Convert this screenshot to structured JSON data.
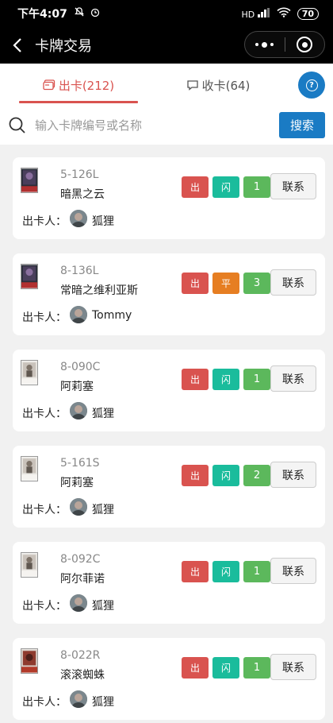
{
  "status_bar": {
    "time": "下午4:07",
    "battery": "70",
    "signal": "HD"
  },
  "nav": {
    "title": "卡牌交易"
  },
  "tabs": {
    "out": {
      "label": "出卡(212)"
    },
    "in": {
      "label": "收卡(64)"
    }
  },
  "search": {
    "placeholder": "输入卡牌编号或名称",
    "value": "",
    "button_label": "搜索"
  },
  "seller_label": "出卡人：",
  "contact_label": "联系",
  "colors": {
    "accent_red": "#d9534f",
    "primary_blue": "#1a7bc4",
    "flash_teal": "#1abc9c",
    "flat_orange": "#e67e22",
    "qty_green": "#5cb85c"
  },
  "cards": [
    {
      "code": "5-126L",
      "name": "暗黑之云",
      "type": "出",
      "finish": "闪",
      "finish_kind": "flash",
      "qty": "1",
      "seller": "狐狸",
      "art": "dark"
    },
    {
      "code": "8-136L",
      "name": "常暗之维利亚斯",
      "type": "出",
      "finish": "平",
      "finish_kind": "flat",
      "qty": "3",
      "seller": "Tommy",
      "art": "dark"
    },
    {
      "code": "8-090C",
      "name": "阿莉塞",
      "type": "出",
      "finish": "闪",
      "finish_kind": "flash",
      "qty": "1",
      "seller": "狐狸",
      "art": "light"
    },
    {
      "code": "5-161S",
      "name": "阿莉塞",
      "type": "出",
      "finish": "闪",
      "finish_kind": "flash",
      "qty": "2",
      "seller": "狐狸",
      "art": "light"
    },
    {
      "code": "8-092C",
      "name": "阿尔菲诺",
      "type": "出",
      "finish": "闪",
      "finish_kind": "flash",
      "qty": "1",
      "seller": "狐狸",
      "art": "light"
    },
    {
      "code": "8-022R",
      "name": "滚滚蜘蛛",
      "type": "出",
      "finish": "闪",
      "finish_kind": "flash",
      "qty": "1",
      "seller": "狐狸",
      "art": "red"
    }
  ]
}
